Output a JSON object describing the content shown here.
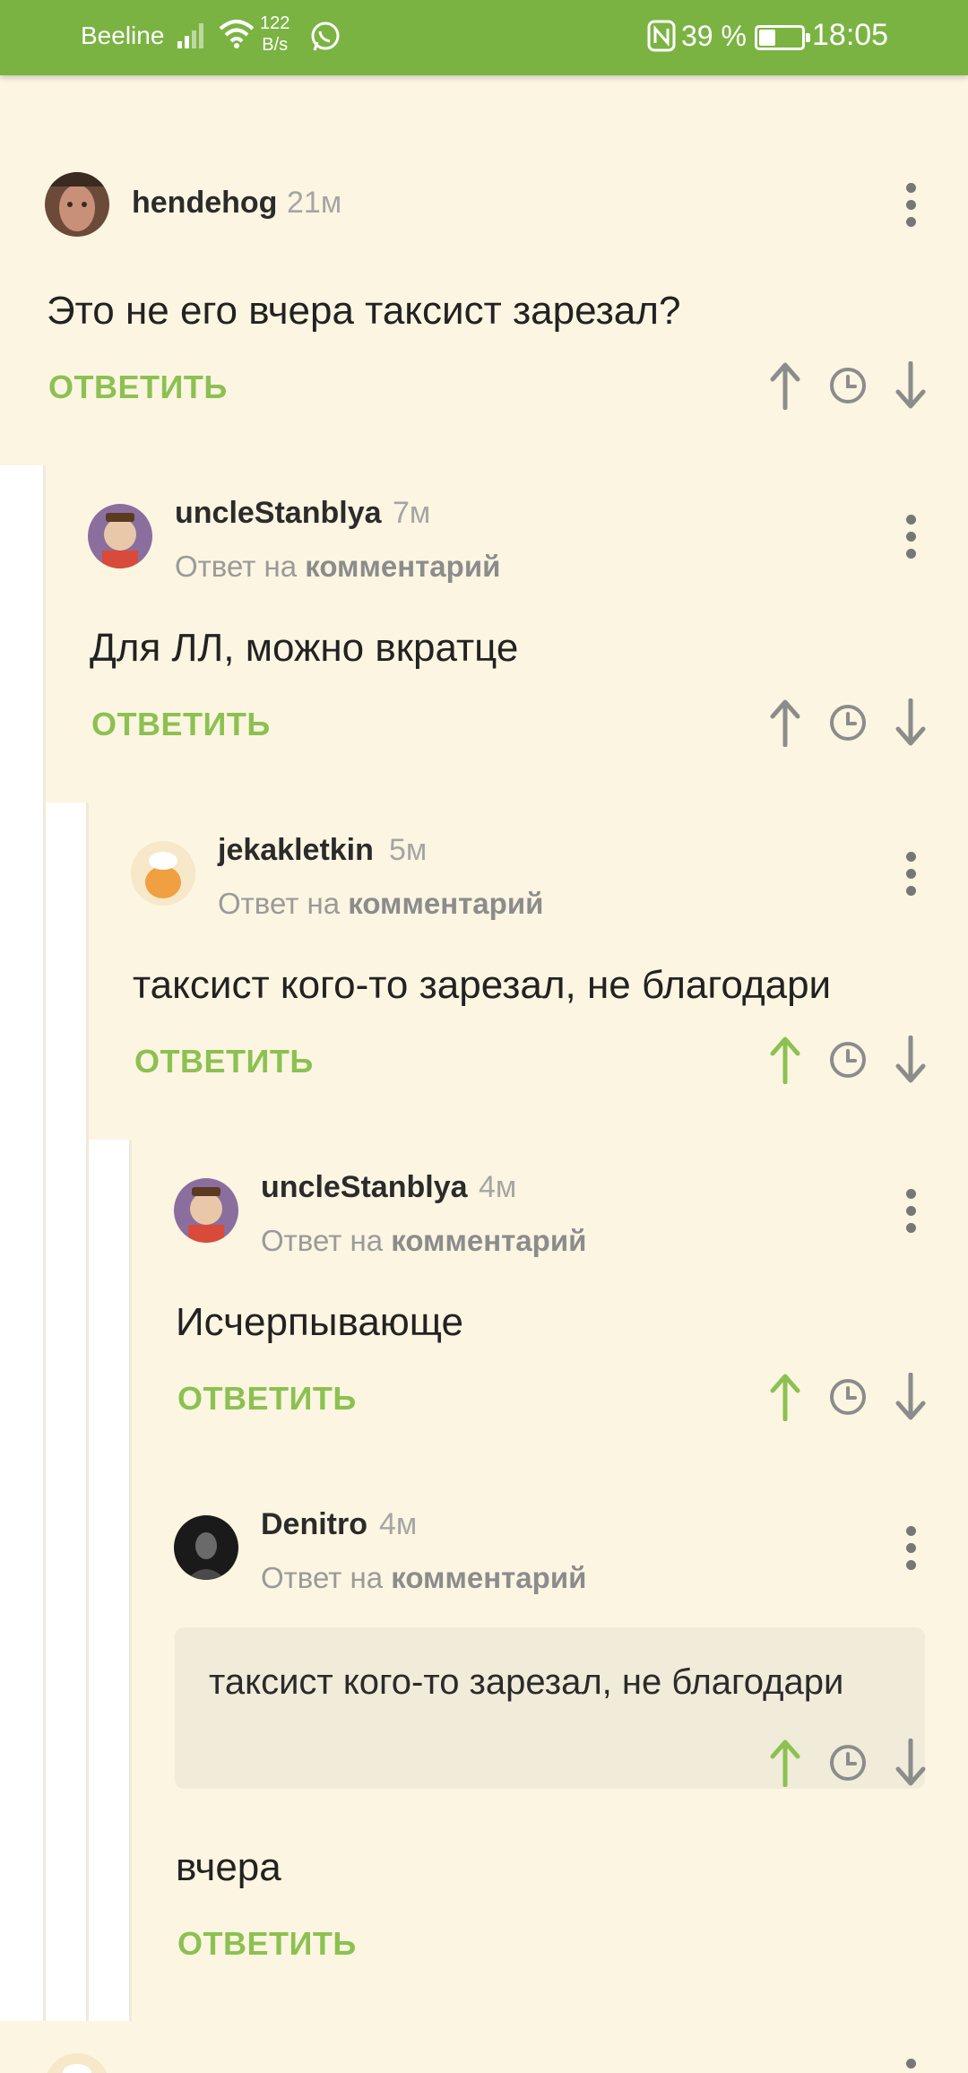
{
  "status_bar": {
    "carrier": "Beeline",
    "speed_value": "122",
    "speed_unit": "B/s",
    "battery_percent": "39 %",
    "battery_level": 0.39,
    "time": "18:05"
  },
  "reply_label": "ОТВЕТИТЬ",
  "reply_to_prefix": "Ответ на",
  "reply_to_link": "комментарий",
  "comments": [
    {
      "author": "hendehog",
      "time": "21м",
      "body": "Это не его вчера таксист зарезал?",
      "upvoted": false
    },
    {
      "author": "uncleStanblya",
      "time": "7м",
      "body": "Для ЛЛ, можно вкратце",
      "upvoted": false
    },
    {
      "author": "jekakletkin",
      "time": "5м",
      "body": "таксист кого-то зарезал, не благодари",
      "upvoted": true
    },
    {
      "author": "uncleStanblya",
      "time": "4м",
      "body": "Исчерпывающе",
      "upvoted": true
    },
    {
      "author": "Denitro",
      "time": "4м",
      "quote": "таксист кого-то зарезал, не благодари",
      "body": "вчера",
      "upvoted": true
    }
  ],
  "colors": {
    "accent_green": "#7bb343",
    "reply_green": "#8cc152",
    "comment_bg": "#fcf5e1",
    "quote_bg": "#f1ebd9"
  }
}
